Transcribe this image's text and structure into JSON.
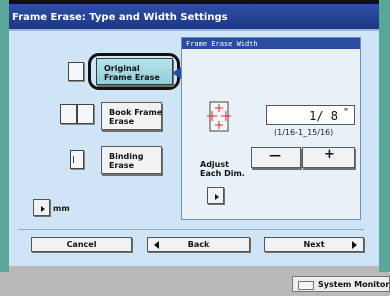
{
  "title": "Frame Erase: Type and Width Settings",
  "options": {
    "original": "Original\nFrame Erase",
    "book": "Book Frame\nErase",
    "binding": "Binding\nErase"
  },
  "unit": "mm",
  "width_panel": {
    "title": "Frame Erase Width",
    "value": "1/ 8",
    "unit_mark": "\"",
    "range": "(1/16-1_15/16)",
    "adjust_label": "Adjust\nEach Dim.",
    "minus": "—",
    "plus": "+"
  },
  "nav": {
    "cancel": "Cancel",
    "back": "Back",
    "next": "Next"
  },
  "system_monitor": "System Monitor",
  "colors": {
    "title_bar": "#1c3583",
    "screen": "#cfe4f4",
    "selected": "#8fcfd9",
    "crop_marks": "#e0262d"
  }
}
